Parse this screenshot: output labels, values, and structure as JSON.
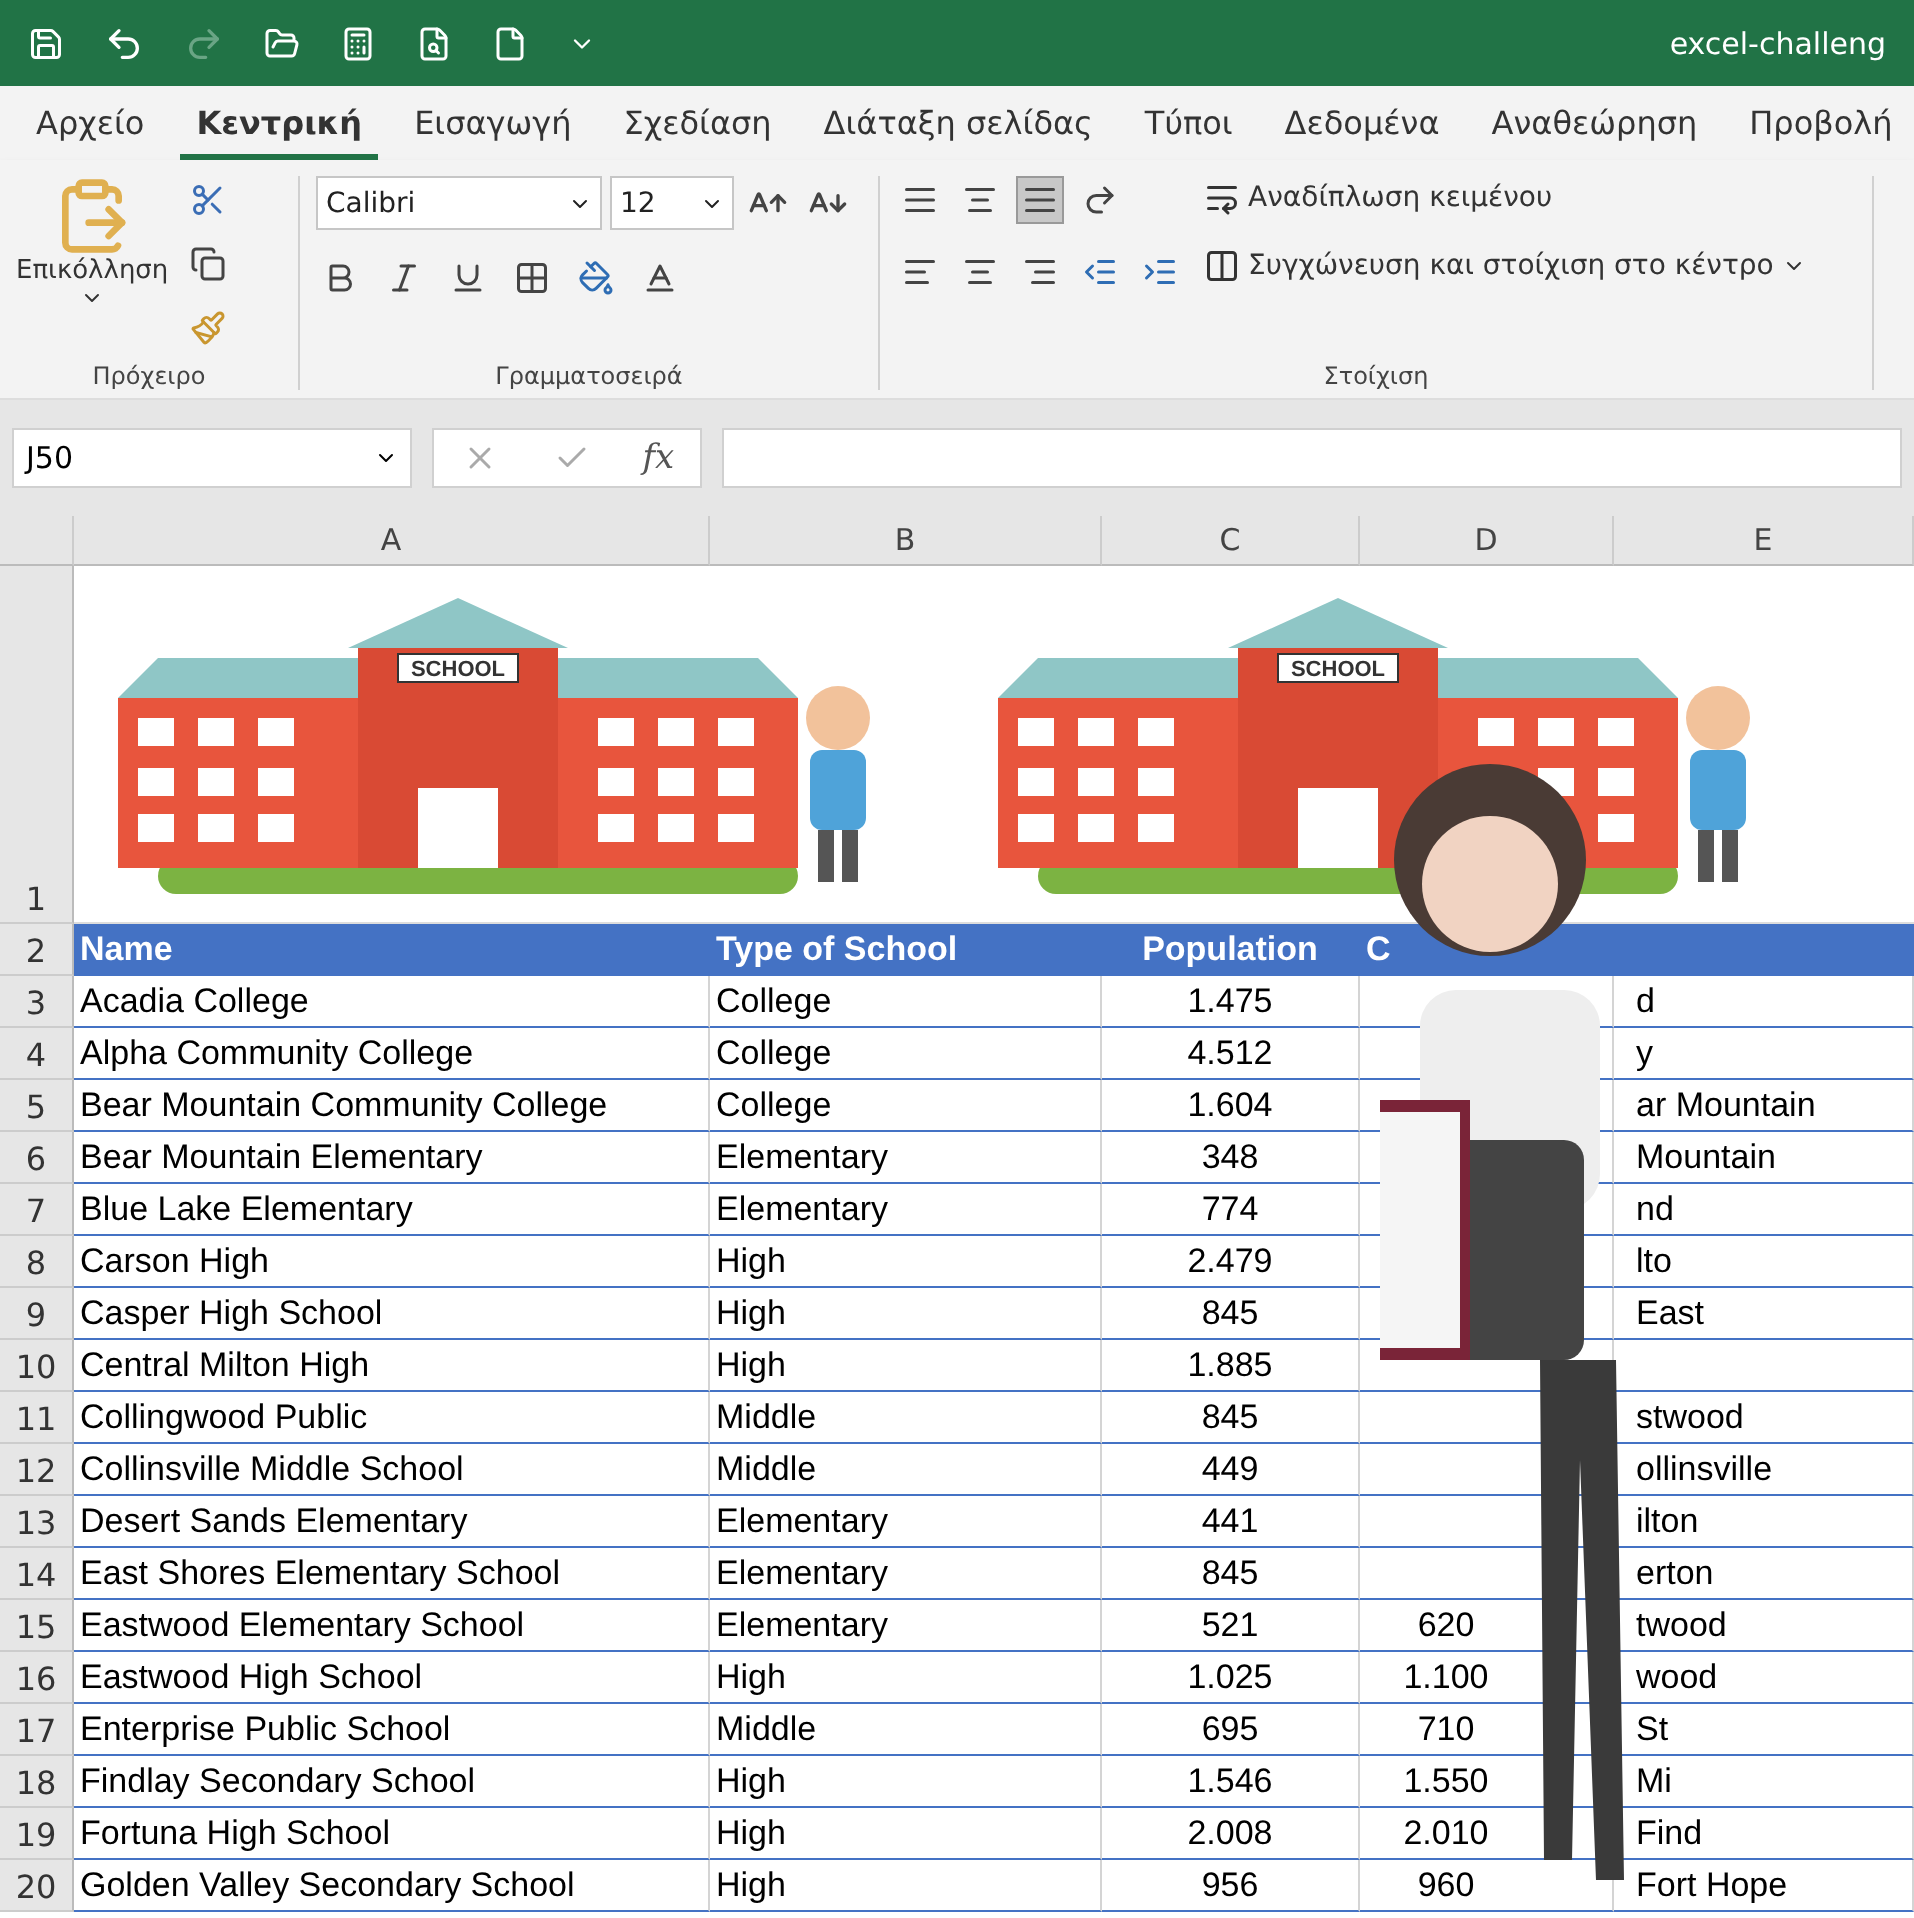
{
  "window": {
    "title": "excel-challeng"
  },
  "quick_access": {
    "redo": {
      "disabled": true
    }
  },
  "tabs": [
    {
      "label": "Αρχείο",
      "selected": false
    },
    {
      "label": "Κεντρική",
      "selected": true
    },
    {
      "label": "Εισαγωγή",
      "selected": false
    },
    {
      "label": "Σχεδίαση",
      "selected": false
    },
    {
      "label": "Διάταξη σελίδας",
      "selected": false
    },
    {
      "label": "Τύποι",
      "selected": false
    },
    {
      "label": "Δεδομένα",
      "selected": false
    },
    {
      "label": "Αναθεώρηση",
      "selected": false
    },
    {
      "label": "Προβολή",
      "selected": false
    }
  ],
  "ribbon": {
    "groups": [
      {
        "kind": "clipboard",
        "label": "Πρόχειρο",
        "paste_label": "Επικόλληση"
      },
      {
        "kind": "font",
        "label": "Γραμματοσειρά",
        "font_name": "Calibri",
        "font_size": "12"
      },
      {
        "kind": "alignment",
        "label": "Στοίχιση",
        "wrap_label": "Αναδίπλωση κειμένου",
        "merge_label": "Συγχώνευση και στοίχιση στο κέντρο",
        "bottom_align_selected": true
      }
    ]
  },
  "formula_bar": {
    "name_box": "J50",
    "function_label": "fx"
  },
  "sheet": {
    "columns": [
      "A",
      "B",
      "C",
      "D",
      "E"
    ],
    "banner": {
      "row_number": "1",
      "signs": [
        "SCHOOL",
        "SCHOOL"
      ]
    },
    "header_row": {
      "row_number": "2",
      "cells": [
        "Name",
        "Type of School",
        "Population",
        "C"
      ]
    },
    "rows": [
      {
        "n": "3",
        "name": "Acadia College",
        "type": "College",
        "population": "1.475",
        "column_5": "d"
      },
      {
        "n": "4",
        "name": "Alpha Community College",
        "type": "College",
        "population": "4.512",
        "column_5": "y"
      },
      {
        "n": "5",
        "name": "Bear Mountain Community College",
        "type": "College",
        "population": "1.604",
        "column_5": "ar Mountain"
      },
      {
        "n": "6",
        "name": "Bear Mountain Elementary",
        "type": "Elementary",
        "population": "348",
        "column_5": "Mountain"
      },
      {
        "n": "7",
        "name": "Blue Lake Elementary",
        "type": "Elementary",
        "population": "774",
        "column_5": "nd"
      },
      {
        "n": "8",
        "name": "Carson High",
        "type": "High",
        "population": "2.479",
        "column_5": "lto"
      },
      {
        "n": "9",
        "name": "Casper High School",
        "type": "High",
        "population": "845",
        "column_5": "East"
      },
      {
        "n": "10",
        "name": "Central Milton High",
        "type": "High",
        "population": "1.885"
      },
      {
        "n": "11",
        "name": "Collingwood Public",
        "type": "Middle",
        "population": "845",
        "column_5": "stwood"
      },
      {
        "n": "12",
        "name": "Collinsville Middle School",
        "type": "Middle",
        "population": "449",
        "column_5": "ollinsville"
      },
      {
        "n": "13",
        "name": "Desert Sands Elementary",
        "type": "Elementary",
        "population": "441",
        "column_5": "ilton"
      },
      {
        "n": "14",
        "name": "East Shores Elementary School",
        "type": "Elementary",
        "population": "845",
        "column_5": "erton"
      },
      {
        "n": "15",
        "name": "Eastwood Elementary School",
        "type": "Elementary",
        "population": "521",
        "column_4": "620",
        "column_5": "twood"
      },
      {
        "n": "16",
        "name": "Eastwood High School",
        "type": "High",
        "population": "1.025",
        "column_4": "1.100",
        "column_5": "wood"
      },
      {
        "n": "17",
        "name": "Enterprise Public School",
        "type": "Middle",
        "population": "695",
        "column_4": "710",
        "column_5": "St"
      },
      {
        "n": "18",
        "name": "Findlay Secondary School",
        "type": "High",
        "population": "1.546",
        "column_4": "1.550",
        "column_5": "Mi"
      },
      {
        "n": "19",
        "name": "Fortuna High School",
        "type": "High",
        "population": "2.008",
        "column_4": "2.010",
        "column_5": "Find"
      },
      {
        "n": "20",
        "name": "Golden Valley Secondary School",
        "type": "High",
        "population": "956",
        "column_4": "960",
        "column_5": "Fort Hope"
      }
    ]
  }
}
